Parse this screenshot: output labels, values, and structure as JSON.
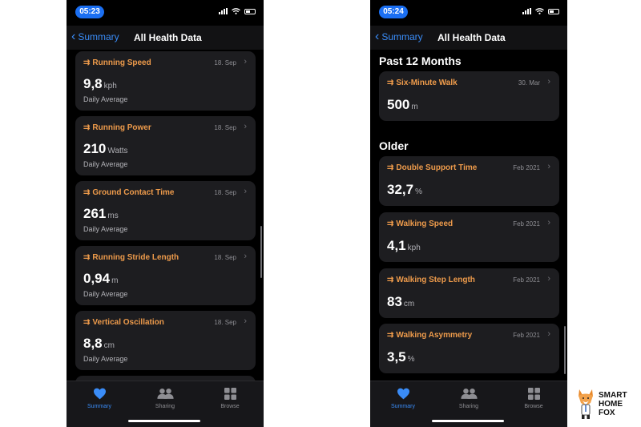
{
  "left": {
    "status_time": "05:23",
    "nav": {
      "back_label": "Summary",
      "title": "All Health Data"
    },
    "cards": [
      {
        "title": "Running Speed",
        "date": "18. Sep",
        "value": "9,8",
        "unit": "kph",
        "subtitle": "Daily Average"
      },
      {
        "title": "Running Power",
        "date": "18. Sep",
        "value": "210",
        "unit": "Watts",
        "subtitle": "Daily Average"
      },
      {
        "title": "Ground Contact Time",
        "date": "18. Sep",
        "value": "261",
        "unit": "ms",
        "subtitle": "Daily Average"
      },
      {
        "title": "Running Stride Length",
        "date": "18. Sep",
        "value": "0,94",
        "unit": "m",
        "subtitle": "Daily Average"
      },
      {
        "title": "Vertical Oscillation",
        "date": "18. Sep",
        "value": "8,8",
        "unit": "cm",
        "subtitle": "Daily Average"
      }
    ],
    "tabs": [
      {
        "label": "Summary",
        "icon": "heart-icon",
        "active": true
      },
      {
        "label": "Sharing",
        "icon": "people-icon",
        "active": false
      },
      {
        "label": "Browse",
        "icon": "grid-icon",
        "active": false
      }
    ]
  },
  "right": {
    "status_time": "05:24",
    "nav": {
      "back_label": "Summary",
      "title": "All Health Data"
    },
    "sections": {
      "past": "Past 12 Months",
      "older": "Older"
    },
    "past_cards": [
      {
        "title": "Six-Minute Walk",
        "date": "30. Mar",
        "value": "500",
        "unit": "m"
      }
    ],
    "older_cards": [
      {
        "title": "Double Support Time",
        "date": "Feb 2021",
        "value": "32,7",
        "unit": "%"
      },
      {
        "title": "Walking Speed",
        "date": "Feb 2021",
        "value": "4,1",
        "unit": "kph"
      },
      {
        "title": "Walking Step Length",
        "date": "Feb 2021",
        "value": "83",
        "unit": "cm"
      },
      {
        "title": "Walking Asymmetry",
        "date": "Feb 2021",
        "value": "3,5",
        "unit": "%"
      }
    ],
    "tabs": [
      {
        "label": "Summary",
        "icon": "heart-icon",
        "active": true
      },
      {
        "label": "Sharing",
        "icon": "people-icon",
        "active": false
      },
      {
        "label": "Browse",
        "icon": "grid-icon",
        "active": false
      }
    ]
  },
  "brand": {
    "line1": "SMART",
    "line2": "HOME",
    "line3": "FOX"
  },
  "colors": {
    "accent_orange": "#ee9b4b",
    "accent_blue": "#3a8cf7",
    "status_pill": "#1b6ff2",
    "card_bg": "#1d1d20"
  }
}
